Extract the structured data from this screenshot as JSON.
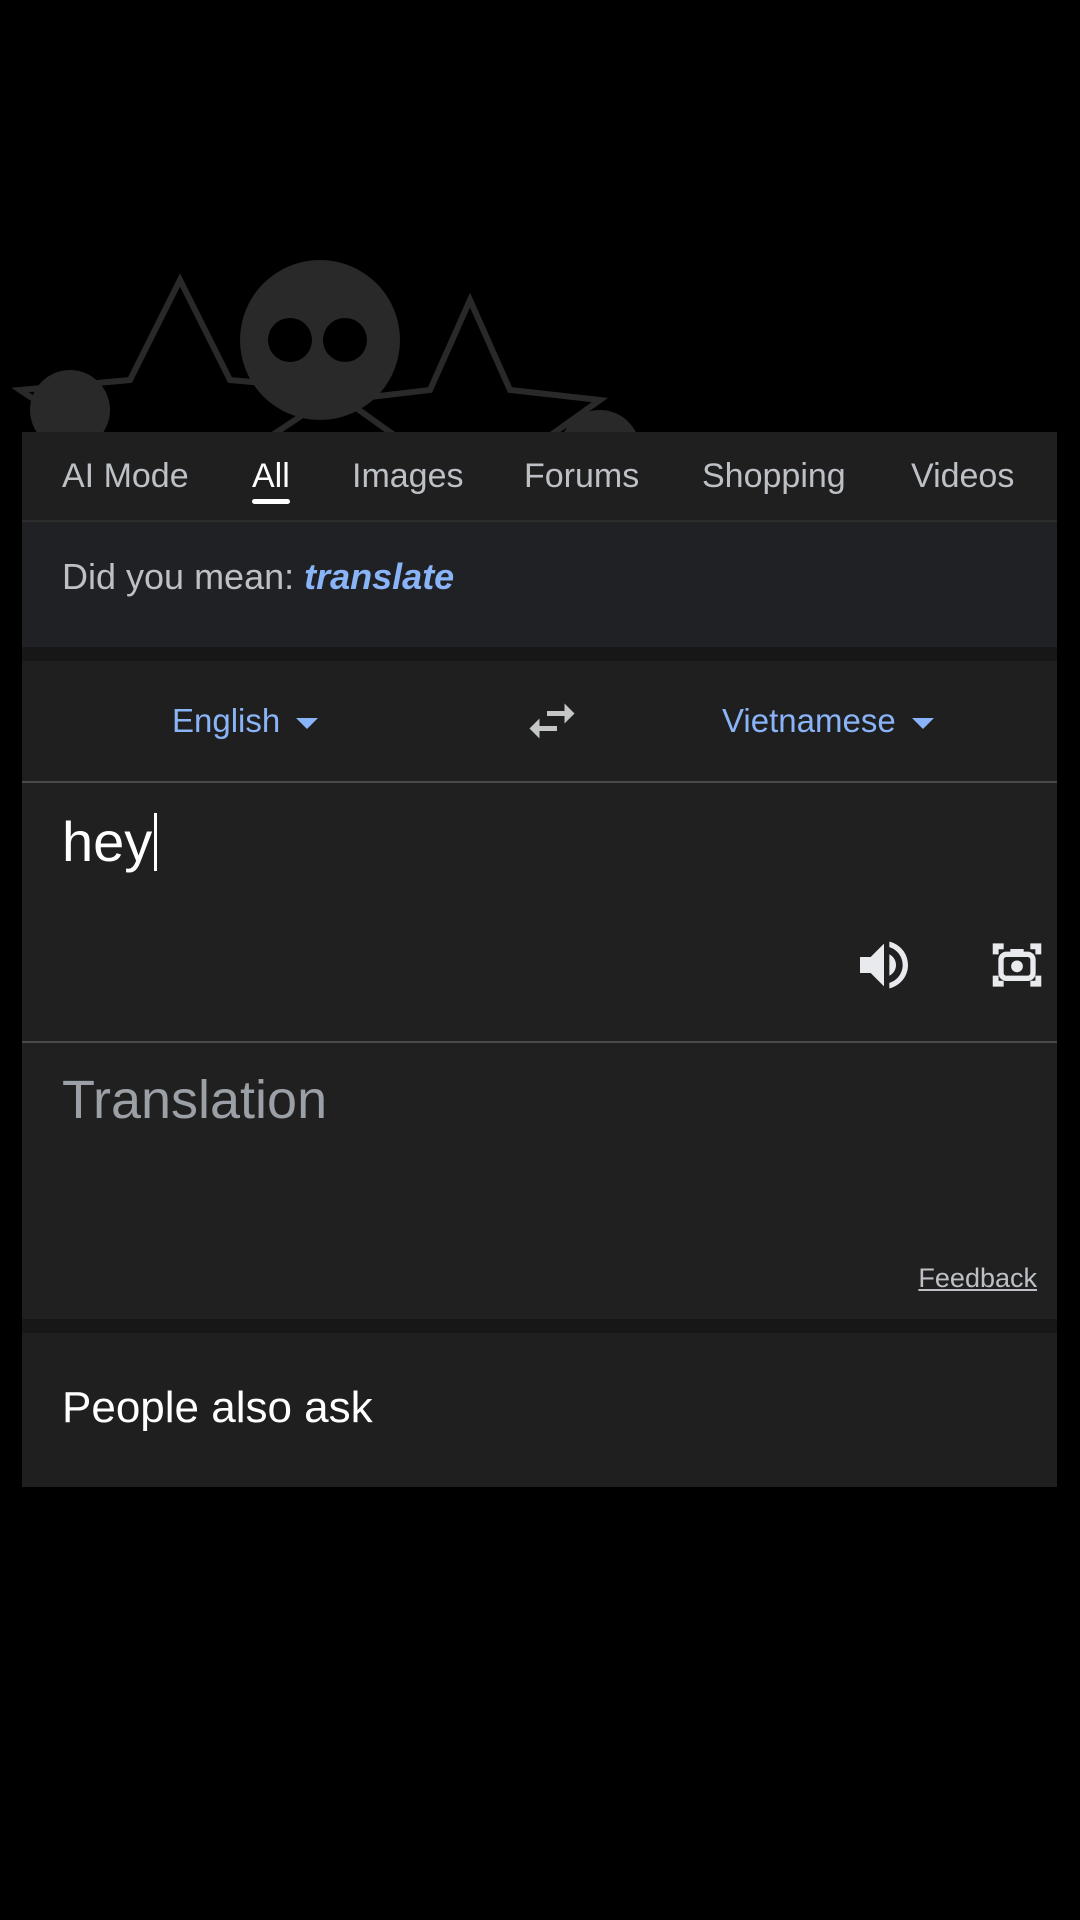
{
  "tabs": [
    {
      "label": "AI Mode",
      "active": false
    },
    {
      "label": "All",
      "active": true
    },
    {
      "label": "Images",
      "active": false
    },
    {
      "label": "Forums",
      "active": false
    },
    {
      "label": "Shopping",
      "active": false
    },
    {
      "label": "Videos",
      "active": false
    }
  ],
  "did_you_mean": {
    "prefix": "Did you mean:",
    "suggestion": "translate"
  },
  "translator": {
    "source_language": "English",
    "target_language": "Vietnamese",
    "input_value": "hey",
    "output_placeholder": "Translation",
    "feedback_label": "Feedback"
  },
  "people_also_ask": {
    "title": "People also ask"
  },
  "icons": {
    "swap": "swap-languages-icon",
    "speaker": "speaker-icon",
    "camera": "camera-lens-icon",
    "caret": "dropdown-caret-icon"
  },
  "colors": {
    "accent": "#8ab4f8",
    "background": "#000000",
    "card": "#202124"
  }
}
